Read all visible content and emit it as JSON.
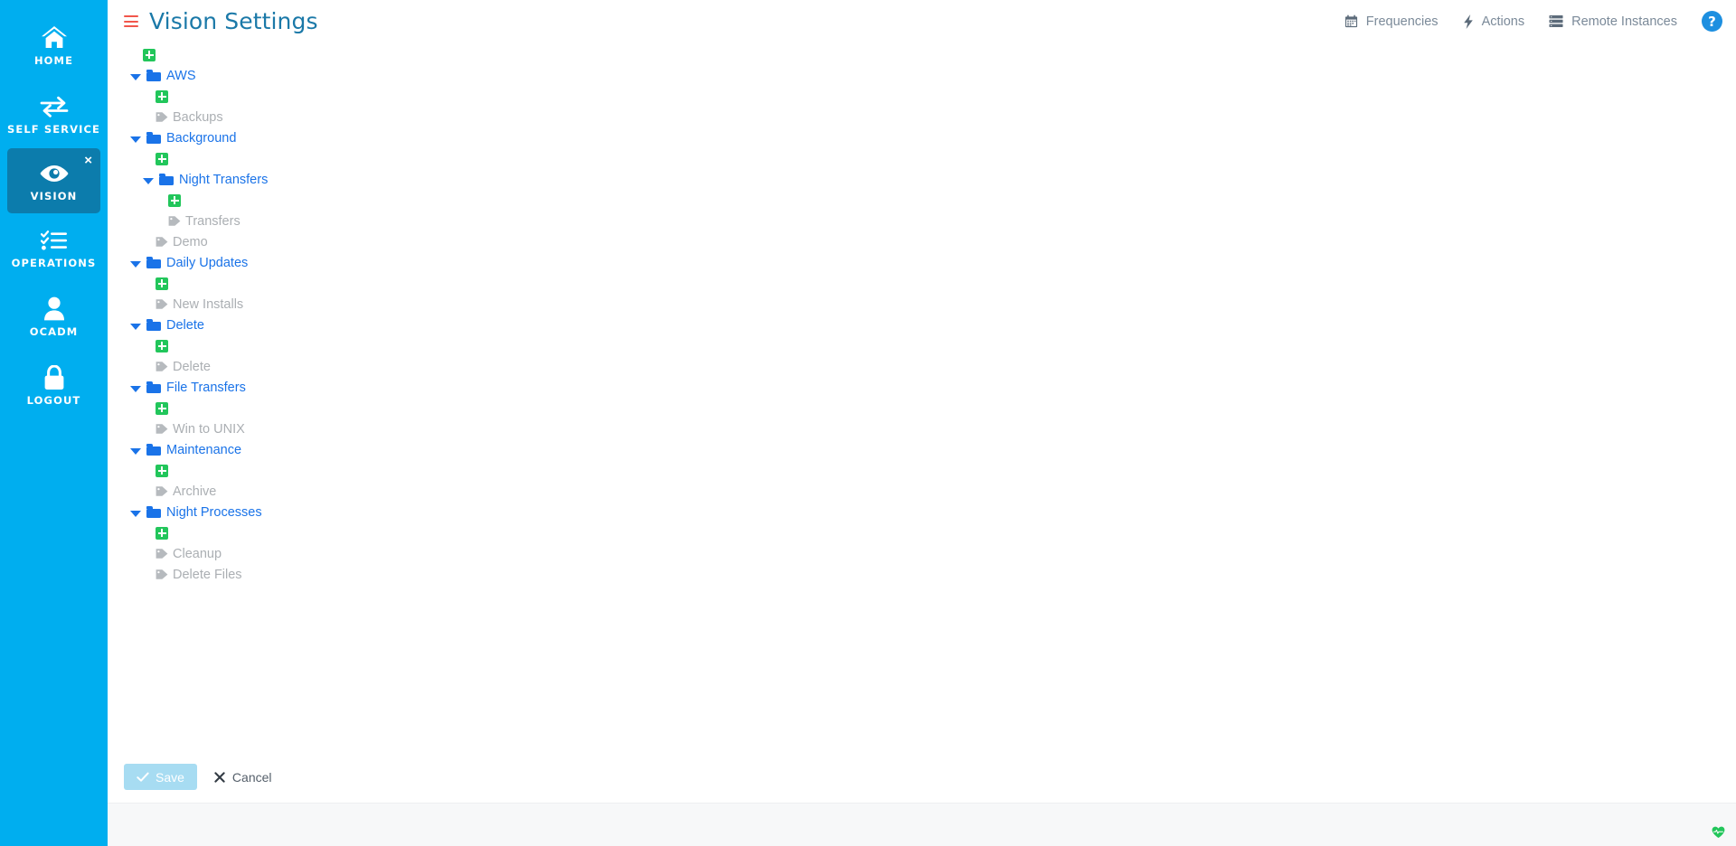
{
  "sidebar": {
    "items": [
      {
        "label": "HOME",
        "icon": "home-icon",
        "active": false
      },
      {
        "label": "SELF SERVICE",
        "icon": "exchange-arrows-icon",
        "active": false
      },
      {
        "label": "VISION",
        "icon": "eye-icon",
        "active": true,
        "close_label": "×"
      },
      {
        "label": "OPERATIONS",
        "icon": "checklist-icon",
        "active": false
      },
      {
        "label": "OCADM",
        "icon": "user-icon",
        "active": false
      },
      {
        "label": "LOGOUT",
        "icon": "lock-icon",
        "active": false
      }
    ]
  },
  "header": {
    "menu_icon": "hamburger-icon",
    "title": "Vision Settings",
    "nav": [
      {
        "label": "Frequencies",
        "icon": "calendar-icon"
      },
      {
        "label": "Actions",
        "icon": "lightning-bolt-icon"
      },
      {
        "label": "Remote Instances",
        "icon": "server-icon"
      }
    ],
    "help_label": "?"
  },
  "colors": {
    "sidebar_bg": "#00AEEF",
    "sidebar_active_bg": "#0C7CAC",
    "title_blue": "#1B79A8",
    "folder_blue": "#1A73E8",
    "tag_gray": "#ABAFB3",
    "plus_green": "#22C65B",
    "hamburger_red": "#F1564B",
    "save_disabled": "#A7DCF2",
    "help_blue": "#1D8FE0"
  },
  "tree": {
    "add_icon": "add-plus-icon",
    "folder_icon": "folder-icon",
    "tag_icon": "tag-icon",
    "caret_icon": "caret-down-icon",
    "root_add": true,
    "nodes": [
      {
        "type": "folder",
        "label": "AWS",
        "expanded": true,
        "indent": 0,
        "children": [
          {
            "type": "add",
            "indent": 1
          },
          {
            "type": "tag",
            "label": "Backups",
            "indent": 1
          }
        ]
      },
      {
        "type": "folder",
        "label": "Background",
        "expanded": true,
        "indent": 0,
        "children": [
          {
            "type": "add",
            "indent": 1
          },
          {
            "type": "folder",
            "label": "Night Transfers",
            "expanded": true,
            "indent": 1,
            "children": [
              {
                "type": "add",
                "indent": 2
              },
              {
                "type": "tag",
                "label": "Transfers",
                "indent": 2
              }
            ]
          },
          {
            "type": "tag",
            "label": "Demo",
            "indent": 1
          }
        ]
      },
      {
        "type": "folder",
        "label": "Daily Updates",
        "expanded": true,
        "indent": 0,
        "children": [
          {
            "type": "add",
            "indent": 1
          },
          {
            "type": "tag",
            "label": "New Installs",
            "indent": 1
          }
        ]
      },
      {
        "type": "folder",
        "label": "Delete",
        "expanded": true,
        "indent": 0,
        "children": [
          {
            "type": "add",
            "indent": 1
          },
          {
            "type": "tag",
            "label": "Delete",
            "indent": 1
          }
        ]
      },
      {
        "type": "folder",
        "label": "File Transfers",
        "expanded": true,
        "indent": 0,
        "children": [
          {
            "type": "add",
            "indent": 1
          },
          {
            "type": "tag",
            "label": "Win to UNIX",
            "indent": 1
          }
        ]
      },
      {
        "type": "folder",
        "label": "Maintenance",
        "expanded": true,
        "indent": 0,
        "children": [
          {
            "type": "add",
            "indent": 1
          },
          {
            "type": "tag",
            "label": "Archive",
            "indent": 1
          }
        ]
      },
      {
        "type": "folder",
        "label": "Night Processes",
        "expanded": true,
        "indent": 0,
        "children": [
          {
            "type": "add",
            "indent": 1
          },
          {
            "type": "tag",
            "label": "Cleanup",
            "indent": 1
          },
          {
            "type": "tag",
            "label": "Delete Files",
            "indent": 1
          }
        ]
      }
    ]
  },
  "footer": {
    "save_label": "Save",
    "save_icon": "check-icon",
    "save_disabled": true,
    "cancel_label": "Cancel",
    "cancel_icon": "close-x-icon",
    "status_icon": "heartbeat-icon"
  }
}
